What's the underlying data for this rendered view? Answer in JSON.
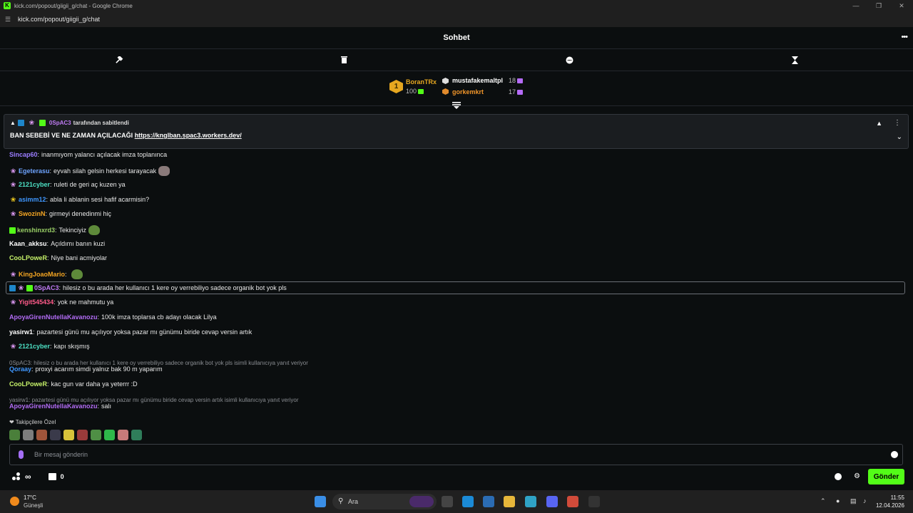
{
  "window": {
    "title": "kick.com/popout/giigii_g/chat - Google Chrome",
    "url": "kick.com/popout/giigii_g/chat"
  },
  "header": {
    "title": "Sohbet"
  },
  "leaderboard": {
    "first": {
      "rank": "1",
      "name": "BoranTRx",
      "count": "100"
    },
    "second": {
      "name": "mustafakemaltpl",
      "count": "18"
    },
    "third": {
      "name": "gorkemkrt",
      "count": "17"
    }
  },
  "pinned": {
    "by_user": "0SpAC3",
    "by_suffix": "tarafından sabitlendi",
    "text": "BAN SEBEBİ VE NE ZAMAN AÇILACAĞI ",
    "link": "https://knglban.spac3.workers.dev/"
  },
  "messages": [
    {
      "user": "Sincap60",
      "color": "#9b7dff",
      "text": "inanmıyom yalancı açılacak imza toplanınca",
      "badges": []
    },
    {
      "user": "Egeterasu",
      "color": "#6ea4ff",
      "text": "eyvah silah gelsin herkesi tarayacak",
      "badges": [
        "sub"
      ],
      "emote": "rat"
    },
    {
      "user": "2121cyber",
      "color": "#4de0c4",
      "text": "ruleti de geri aç kuzen ya",
      "badges": [
        "sub"
      ]
    },
    {
      "user": "asimm12",
      "color": "#3f97ff",
      "text": "abla li ablanin sesi hafif acarmisin?",
      "badges": [
        "subgold"
      ]
    },
    {
      "user": "SwozinN",
      "color": "#f5a623",
      "text": "girmeyi denedinmi hiç",
      "badges": [
        "sub"
      ]
    },
    {
      "user": "kenshinxrd3",
      "color": "#9ad066",
      "text": "Tekinciyiz",
      "badges": [
        "founder"
      ],
      "emote": "frog"
    },
    {
      "user": "Kaan_akksu",
      "color": "#ffffff",
      "text": "Açıldımı banın kuzi",
      "badges": []
    },
    {
      "user": "CooLPoweR",
      "color": "#c7f36a",
      "text": "Niye bani acmiyolar",
      "badges": []
    },
    {
      "user": "KingJoaoMario",
      "color": "#f5a623",
      "text": "",
      "badges": [
        "sub"
      ],
      "emote": "frog"
    },
    {
      "user": "0SpAC3",
      "color": "#c07cf5",
      "text": "hilesiz o bu arada her kullanıcı 1 kere oy verrebiliyo sadece organik bot yok pls",
      "badges": [
        "blue",
        "sub",
        "founder"
      ]
    },
    {
      "user": "Yigit545434",
      "color": "#ff5c8a",
      "text": "yok ne mahmutu ya",
      "badges": [
        "sub"
      ]
    },
    {
      "user": "ApoyaGirenNutellaKavanozu",
      "color": "#b26cf5",
      "text": "100k imza toplarsa cb adayı olacak Lilya",
      "badges": []
    },
    {
      "user": "yasirw1",
      "color": "#ffffff",
      "text": "pazartesi günü mu açılıyor yoksa pazar mı günümu biride cevap versin artık",
      "badges": []
    },
    {
      "user": "2121cyber",
      "color": "#4de0c4",
      "text": "kapı skışmış",
      "badges": [
        "sub"
      ]
    },
    {
      "reply_to": "0SpAC3: hilesiz o bu arada her kullanıcı 1 kere oy verrebiliyo sadece organik bot yok pls isimli kullanıcıya yanıt veriyor",
      "user": "Qoraay",
      "color": "#3f97ff",
      "text": "proxyi acarım simdi yalnız bak 90 m yaparım",
      "badges": []
    },
    {
      "user": "CooLPoweR",
      "color": "#c7f36a",
      "text": "kac gun var daha ya yeterrr :D",
      "badges": []
    },
    {
      "reply_to": "yasirw1: pazartesi günü mu açılıyor yoksa pazar mı günümu biride cevap versin artık isimli kullanıcıya yanıt veriyor",
      "user": "ApoyaGirenNutellaKavanozu",
      "color": "#b26cf5",
      "text": "salı",
      "badges": []
    }
  ],
  "emote_section": {
    "title": "Takipçilere Özel"
  },
  "input": {
    "placeholder": "Bir mesaj gönderin"
  },
  "bottom": {
    "points": "∞",
    "store_count": "0",
    "send_label": "Gönder"
  },
  "taskbar": {
    "temp": "17°C",
    "weather": "Güneşli",
    "search": "Ara",
    "time": "11:55",
    "date": "12.04.2026"
  }
}
